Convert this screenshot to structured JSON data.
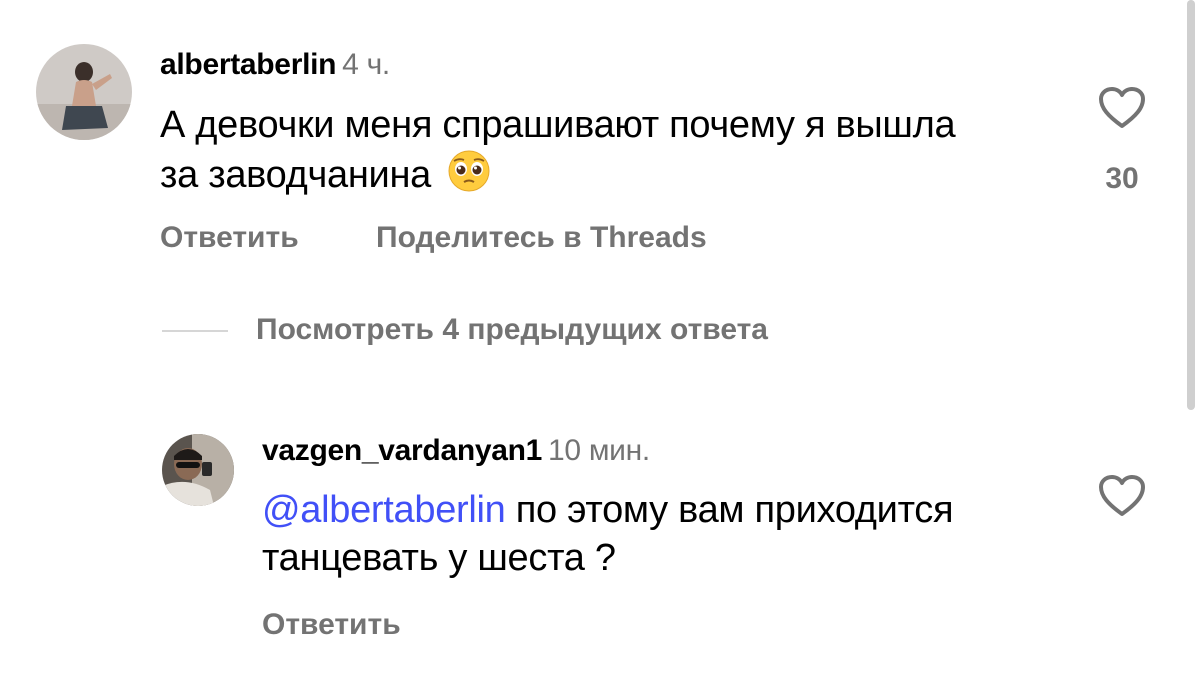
{
  "comments": [
    {
      "username": "albertaberlin",
      "time": "4 ч.",
      "text": "А девочки меня спрашивают почему я вышла за заводчанина",
      "emoji": "pleading-face",
      "like_count": "30",
      "actions": {
        "reply": "Ответить",
        "share": "Поделитесь в Threads"
      }
    },
    {
      "username": "vazgen_vardanyan1",
      "time": "10 мин.",
      "mention": "@albertaberlin",
      "text": "по этому вам приходится танцевать у шеста ?",
      "actions": {
        "reply": "Ответить"
      }
    }
  ],
  "view_previous_replies": "Посмотреть 4 предыдущих ответа",
  "colors": {
    "mention": "#4150f7",
    "secondary_text": "#737373",
    "divider": "#d6d6d6"
  }
}
